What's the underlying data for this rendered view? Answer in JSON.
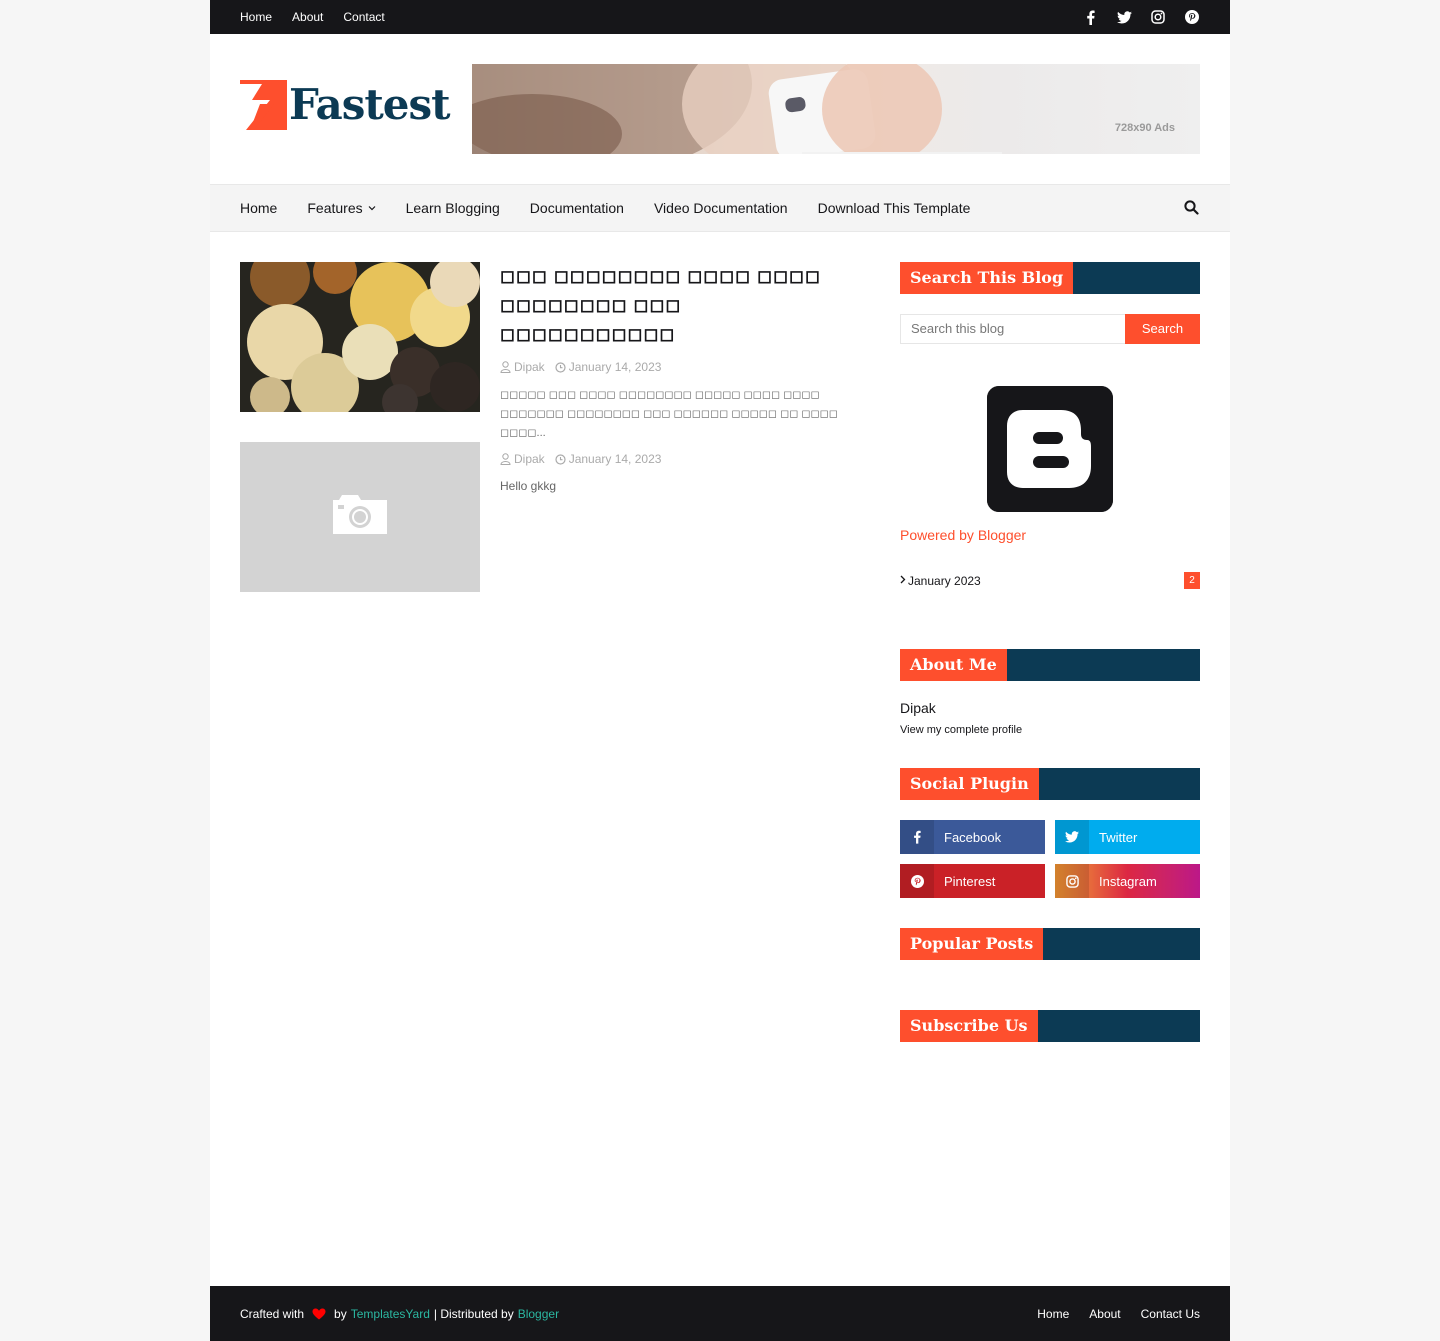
{
  "topbar": {
    "links": [
      "Home",
      "About",
      "Contact"
    ],
    "social_icons": [
      "facebook-icon",
      "twitter-icon",
      "instagram-icon",
      "pinterest-icon"
    ]
  },
  "header": {
    "logo_text": "Fastest",
    "ad_label": "728x90 Ads"
  },
  "nav": {
    "items": [
      "Home",
      "Features",
      "Learn Blogging",
      "Documentation",
      "Video Documentation",
      "Download This Template"
    ],
    "search_icon": "search-icon"
  },
  "posts": [
    {
      "title": "◻◻◻ ◻◻◻◻◻◻◻◻ ◻◻◻◻ ◻◻◻◻ ◻◻◻◻◻◻◻◻ ◻◻◻ ◻◻◻◻◻◻◻◻◻◻◻",
      "author": "Dipak",
      "date": "January 14, 2023",
      "snippet": "◻◻◻◻◻ ◻◻◻ ◻◻◻◻ ◻◻◻◻◻◻◻◻ ◻◻◻◻◻ ◻◻◻◻ ◻◻◻◻ ◻◻◻◻◻◻◻ ◻◻◻◻◻◻◻◻ ◻◻◻ ◻◻◻◻◻◻ ◻◻◻◻◻ ◻◻ ◻◻◻◻ ◻◻◻◻..."
    },
    {
      "title": "",
      "author": "Dipak",
      "date": "January 14, 2023",
      "snippet": "Hello gkkg"
    }
  ],
  "sidebar": {
    "search_title": "Search This Blog",
    "search_placeholder": "Search this blog",
    "search_button": "Search",
    "powered": "Powered by Blogger",
    "archive": {
      "label": "January 2023",
      "count": "2"
    },
    "about_title": "About Me",
    "about_name": "Dipak",
    "about_link": "View my complete profile",
    "social_title": "Social Plugin",
    "social": [
      {
        "label": "Facebook",
        "icon": "facebook-icon",
        "color": "#3b5999"
      },
      {
        "label": "Twitter",
        "icon": "twitter-icon",
        "color": "#00acee"
      },
      {
        "label": "Pinterest",
        "icon": "pinterest-icon",
        "color": "#ca2127"
      },
      {
        "label": "Instagram",
        "icon": "instagram-icon",
        "color": "#dd277b"
      }
    ],
    "popular_title": "Popular Posts",
    "subscribe_title": "Subscribe Us"
  },
  "footer": {
    "crafted": "Crafted with",
    "by": "by",
    "templatesyard": "TemplatesYard",
    "distributed": "| Distributed by",
    "blogger": "Blogger",
    "links": [
      "Home",
      "About",
      "Contact Us"
    ]
  },
  "colors": {
    "accent": "#fe4f2d",
    "navy": "#0c3a54",
    "dark": "#161619"
  }
}
